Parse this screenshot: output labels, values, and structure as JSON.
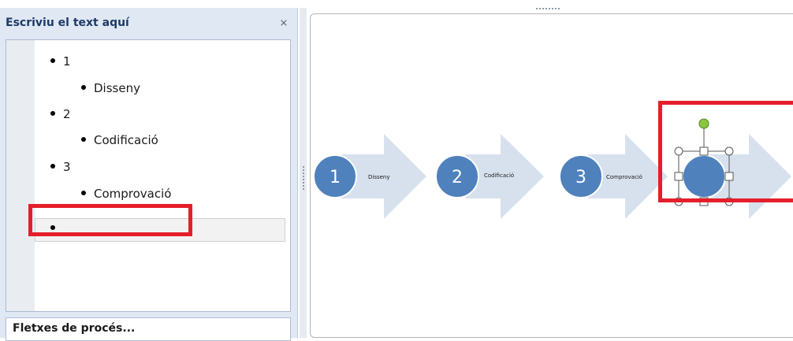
{
  "text_pane": {
    "title": "Escriviu el text aquí",
    "close_icon": "close-icon",
    "items": [
      {
        "level": 1,
        "text": "1"
      },
      {
        "level": 2,
        "text": "Disseny"
      },
      {
        "level": 1,
        "text": "2"
      },
      {
        "level": 2,
        "text": "Codificació"
      },
      {
        "level": 1,
        "text": "3"
      },
      {
        "level": 2,
        "text": "Comprovació"
      },
      {
        "level": 1,
        "text": ""
      }
    ],
    "footer_label": "Fletxes de procés..."
  },
  "diagram": {
    "steps": [
      {
        "number": "1",
        "label": "Disseny"
      },
      {
        "number": "2",
        "label": "Codificació"
      },
      {
        "number": "3",
        "label": "Comprovació"
      },
      {
        "number": "",
        "label": ""
      }
    ]
  },
  "colors": {
    "circle": "#4f81bd",
    "arrow": "#d7e1ee",
    "highlight": "#e41e2a"
  }
}
